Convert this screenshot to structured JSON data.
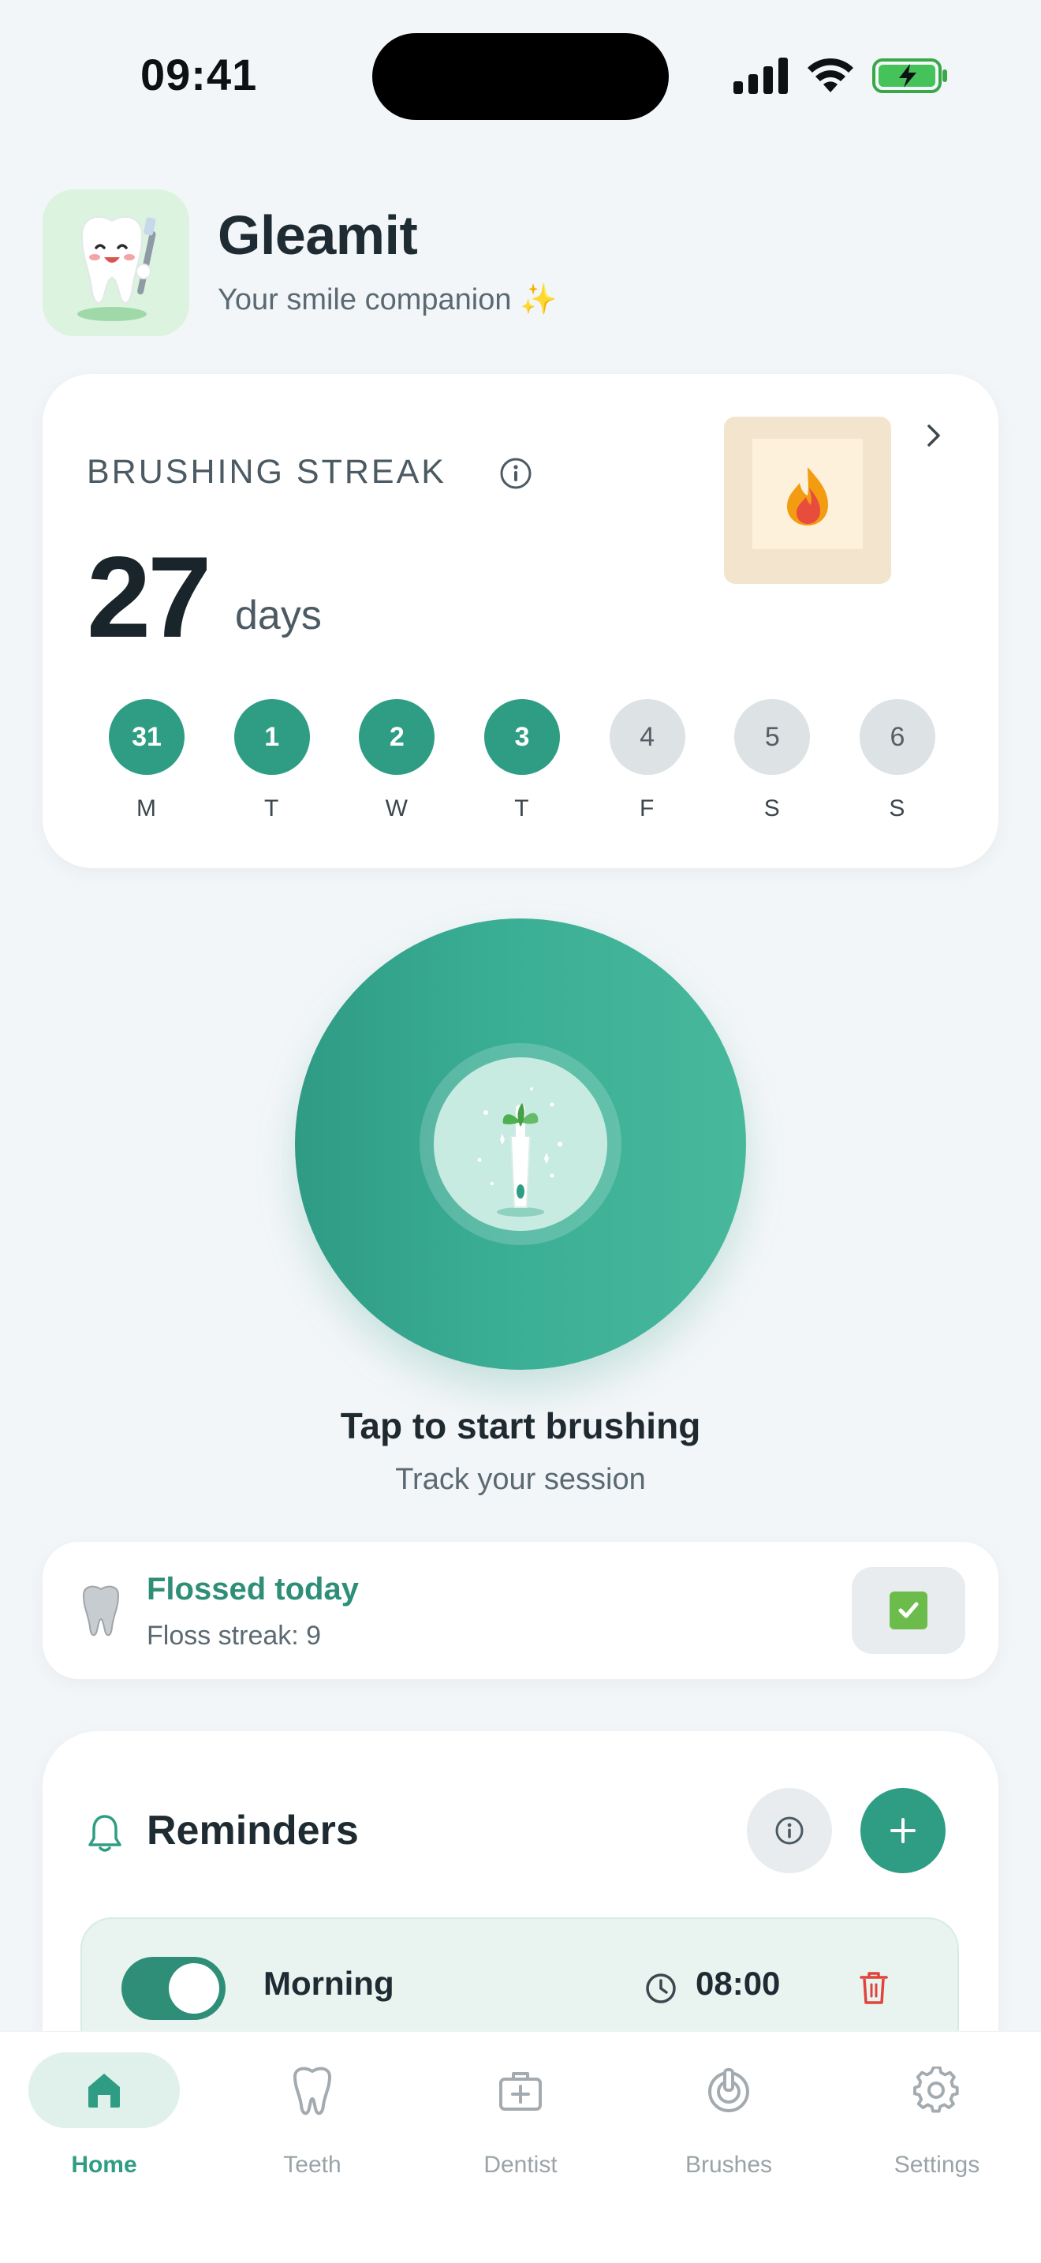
{
  "status_bar": {
    "time": "09:41"
  },
  "header": {
    "app_name": "Gleamit",
    "subtitle": "Your smile companion",
    "subtitle_emoji": "✨"
  },
  "streak": {
    "label": "BRUSHING STREAK",
    "count": "27",
    "unit": "days",
    "days": [
      {
        "date": "31",
        "letter": "M",
        "done": true
      },
      {
        "date": "1",
        "letter": "T",
        "done": true
      },
      {
        "date": "2",
        "letter": "W",
        "done": true
      },
      {
        "date": "3",
        "letter": "T",
        "done": true
      },
      {
        "date": "4",
        "letter": "F",
        "done": false
      },
      {
        "date": "5",
        "letter": "S",
        "done": false
      },
      {
        "date": "6",
        "letter": "S",
        "done": false
      }
    ]
  },
  "brush": {
    "title": "Tap to start brushing",
    "subtitle": "Track your session"
  },
  "floss": {
    "title": "Flossed today",
    "streak_text": "Floss streak: 9",
    "checked": true
  },
  "reminders": {
    "title": "Reminders",
    "items": [
      {
        "name": "Morning",
        "time": "08:00",
        "enabled": true
      }
    ]
  },
  "tabs": [
    {
      "label": "Home",
      "icon": "home-icon",
      "active": true
    },
    {
      "label": "Teeth",
      "icon": "tooth-icon",
      "active": false
    },
    {
      "label": "Dentist",
      "icon": "medical-kit-icon",
      "active": false
    },
    {
      "label": "Brushes",
      "icon": "brush-head-icon",
      "active": false
    },
    {
      "label": "Settings",
      "icon": "gear-icon",
      "active": false
    }
  ],
  "colors": {
    "accent": "#2e9d84",
    "accent_dark": "#2e8e77",
    "background": "#f3f6f8",
    "inactive_day": "#dde2e5",
    "danger": "#e0443c"
  }
}
